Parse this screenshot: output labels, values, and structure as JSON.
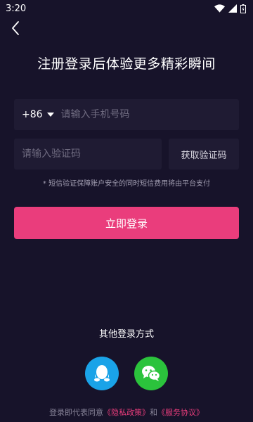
{
  "status_bar": {
    "time": "3:20",
    "icons": [
      "wifi-icon",
      "signal-icon",
      "battery-icon"
    ]
  },
  "header": {
    "back_icon": "chevron-left-icon",
    "title": "注册登录后体验更多精彩瞬间"
  },
  "form": {
    "country_code": "+86",
    "phone_placeholder": "请输入手机号码",
    "code_placeholder": "请输入验证码",
    "get_code_label": "获取验证码",
    "notice": "* 短信验证保障账户安全的同时短信费用将由平台支付",
    "login_label": "立即登录"
  },
  "other_login": {
    "label": "其他登录方式",
    "options": [
      {
        "name": "qq",
        "icon": "qq-penguin-icon"
      },
      {
        "name": "wechat",
        "icon": "wechat-icon"
      }
    ]
  },
  "agreement": {
    "prefix": "登录即代表同意",
    "privacy_link": "《隐私政策》",
    "conjunction": "和",
    "terms_link": "《服务协议》"
  },
  "colors": {
    "background": "#17132a",
    "field_background": "#1f1b33",
    "accent": "#ea3d7c",
    "qq": "#1aa3e8",
    "wechat": "#2bc33c"
  }
}
